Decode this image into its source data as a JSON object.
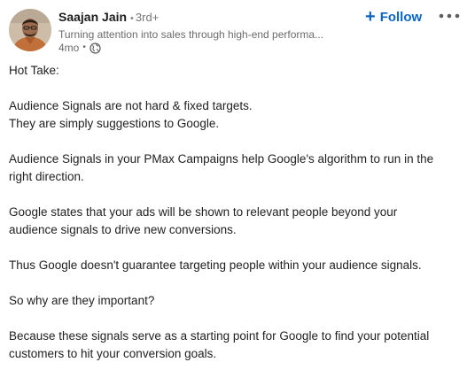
{
  "author": {
    "name": "Saajan Jain",
    "degree": "3rd+",
    "headline": "Turning attention into sales through high-end performa...",
    "time": "4mo",
    "visibility_icon": "globe-icon"
  },
  "actions": {
    "follow_label": "Follow",
    "follow_icon": "plus-icon",
    "more_icon": "more-options-icon"
  },
  "colors": {
    "accent": "#0a66c2",
    "secondary_text": "#6b6b6b"
  },
  "post": {
    "paragraphs": [
      [
        "Hot Take:"
      ],
      [
        "Audience Signals are not hard & fixed targets.",
        "They are simply suggestions to Google."
      ],
      [
        "Audience Signals in your PMax Campaigns help Google's algorithm to run in the",
        "right direction."
      ],
      [
        "Google states that your ads will be shown to relevant people beyond your",
        "audience signals to drive new conversions."
      ],
      [
        "Thus Google doesn't guarantee targeting people within your audience signals."
      ],
      [
        "So why are they important?"
      ],
      [
        "Because these signals serve as a starting point for Google to find your potential",
        "customers to hit your conversion goals."
      ]
    ]
  }
}
